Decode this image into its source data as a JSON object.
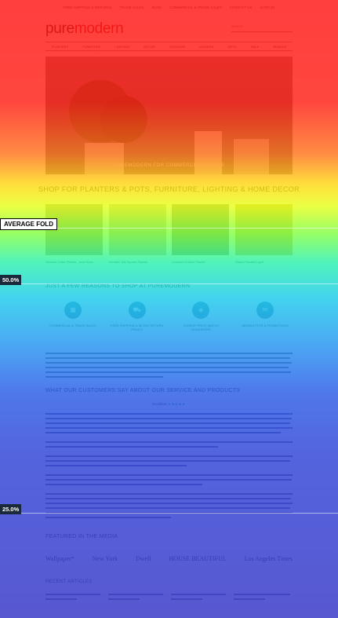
{
  "site": {
    "topbar": [
      "FREE SHIPPING & RETURNS",
      "TRADE SALES",
      "BLOG",
      "COMMERCIAL & TRADE SALES",
      "CONTACT US",
      "CART (0)"
    ],
    "logo_part1": "pure",
    "logo_part2": "modern",
    "search_placeholder": "Search",
    "nav": [
      "PLANTERS",
      "FURNITURE",
      "LIGHTING",
      "DECOR",
      "OUTDOOR",
      "MODERN",
      "GIFTS",
      "SALE",
      "BRANDS"
    ],
    "hero_caption": "PUREMODERN FOR COMMERCIAL SPACES",
    "shop_title": "SHOP FOR PLANTERS & POTS, FURNITURE, LIGHTING & HOME DECOR",
    "products": [
      "Veradek Cube Planter - Inca Hues",
      "Veradek Tall Square Planter",
      "Lechuza Cubico Planter",
      "Glass Pendant Light"
    ],
    "reasons_title": "JUST A FEW REASONS TO SHOP AT PUREMODERN",
    "reasons": [
      {
        "icon": "building-icon",
        "label": "COMMERCIAL & TRADE SALES"
      },
      {
        "icon": "truck-icon",
        "label": "FREE SHIPPING & 30-DAY RETURN POLICY"
      },
      {
        "icon": "tag-icon",
        "label": "LOWEST PRICE MATCH GUARANTEE"
      },
      {
        "icon": "mail-icon",
        "label": "NEWSLETTER & PROMOTIONS"
      }
    ],
    "testimonials_title": "WHAT OUR CUSTOMERS SAY ABOUT OUR SERVICE AND PRODUCTS",
    "rating_label": "Excellent",
    "rating_stars": "★★★★★",
    "press_title": "FEATURED IN THE MEDIA",
    "press": [
      "Wallpaper*",
      "New York",
      "Dwell",
      "HOUSE BEAUTIFUL",
      "Los Angeles Times"
    ],
    "articles_title": "RECENT ARTICLES"
  },
  "folds": {
    "average": "AVERAGE FOLD",
    "p50": "50.0%",
    "p25": "25.0%"
  },
  "heatmap_colors": {
    "hot": "#ff1414",
    "warm": "#ffd70a",
    "mid": "#14c8eb",
    "cool": "#3c3cc8"
  }
}
